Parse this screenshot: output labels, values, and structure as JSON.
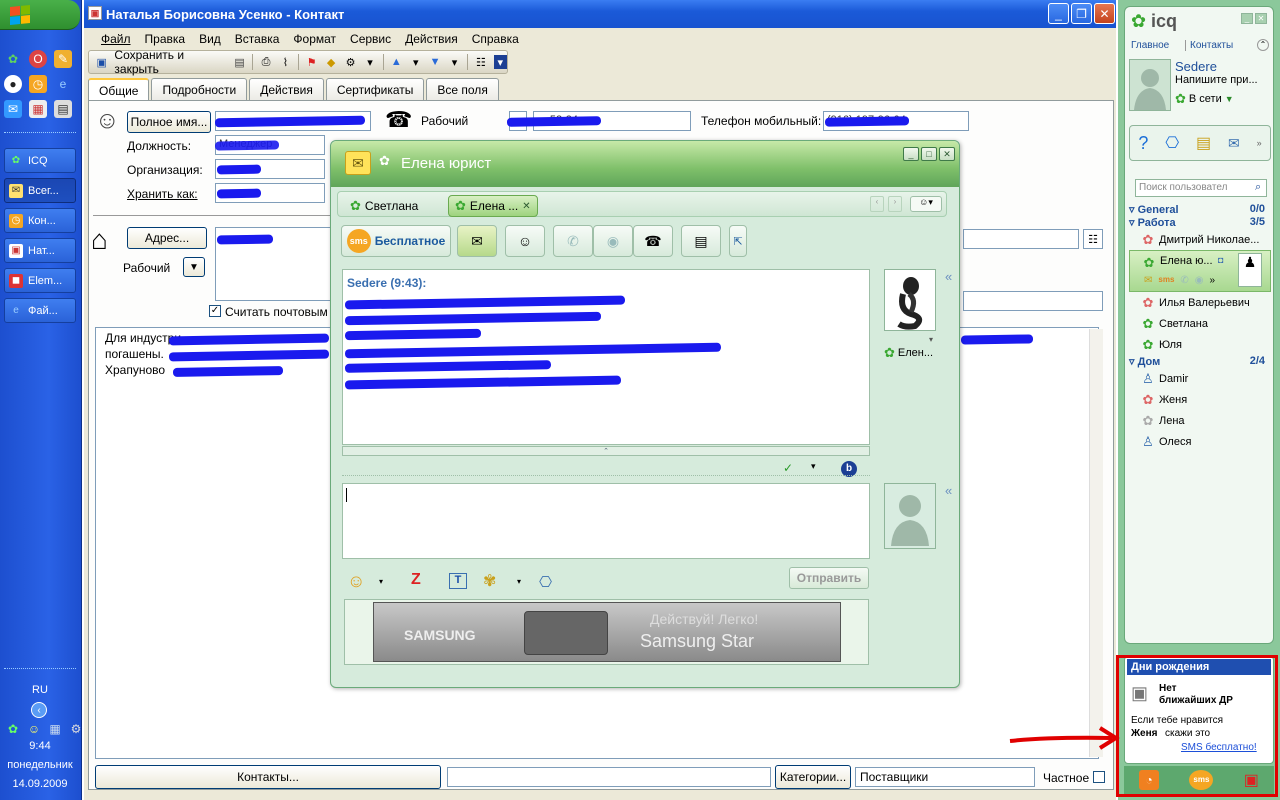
{
  "taskbar": {
    "start_label": "",
    "tasks": [
      {
        "label": "ICQ",
        "icon": "icq-flower-icon"
      },
      {
        "label": "Всег...",
        "icon": "envelope-icon"
      },
      {
        "label": "Кон...",
        "icon": "clock-icon"
      },
      {
        "label": "Нат...",
        "icon": "contact-card-icon"
      },
      {
        "label": "Elem...",
        "icon": "app-icon"
      },
      {
        "label": "Фай...",
        "icon": "ie-icon"
      }
    ],
    "lang": "RU",
    "time": "9:44",
    "day": "понедельник",
    "date": "14.09.2009"
  },
  "outlook": {
    "title": "Наталья Борисовна Усенко - Контакт",
    "menu": [
      "Файл",
      "Правка",
      "Вид",
      "Вставка",
      "Формат",
      "Сервис",
      "Действия",
      "Справка"
    ],
    "toolbar": {
      "save_close": "Сохранить и закрыть"
    },
    "tabs": [
      "Общие",
      "Подробности",
      "Действия",
      "Сертификаты",
      "Все поля"
    ],
    "fullname_btn": "Полное имя...",
    "labels": {
      "position": "Должность:",
      "organization": "Организация:",
      "save_as": "Хранить как:",
      "phone_work": "Рабочий",
      "phone_mobile": "Телефон мобильный:",
      "address_btn": "Адрес...",
      "address_type": "Рабочий",
      "postal": "Считать почтовым"
    },
    "values": {
      "position": "Менеджер",
      "phone_work": "...-52-24",
      "phone_mobile": "(916) 197-96-04"
    },
    "notes": [
      "Для индустри",
      "погашены.",
      "Храпуново"
    ],
    "bottom": {
      "contacts_btn": "Контакты...",
      "categories_btn": "Категории...",
      "categories_value": "Поставщики",
      "private_label": "Частное"
    }
  },
  "chat": {
    "title": "Елена юрист",
    "tabs": [
      {
        "label": "Светлана",
        "active": false
      },
      {
        "label": "Елена ...",
        "active": true
      }
    ],
    "sms_btn": "Бесплатное",
    "message_header": "Sedere (9:43):",
    "contact_name": "Елен...",
    "send_btn": "Отправить",
    "ad_text_1": "SAMSUNG",
    "ad_text_2": "Действуй! Легко!",
    "ad_text_3": "Samsung Star"
  },
  "icq": {
    "logo": "icq",
    "nav": [
      "Главное",
      "Контакты"
    ],
    "user": {
      "name": "Sedere",
      "status_msg": "Напишите при...",
      "status": "В сети"
    },
    "search_placeholder": "Поиск пользовател",
    "groups": [
      {
        "name": "General",
        "count": "0/0",
        "contacts": []
      },
      {
        "name": "Работа",
        "count": "3/5",
        "contacts": [
          {
            "name": "Дмитрий Николае...",
            "status": "offline"
          },
          {
            "name": "Елена ю...",
            "status": "online",
            "selected": true
          },
          {
            "name": "Илья Валерьевич",
            "status": "offline"
          },
          {
            "name": "Светлана",
            "status": "online"
          },
          {
            "name": "Юля",
            "status": "online"
          }
        ]
      },
      {
        "name": "Дом",
        "count": "2/4",
        "contacts": [
          {
            "name": "Damir",
            "status": "away"
          },
          {
            "name": "Женя",
            "status": "offline"
          },
          {
            "name": "Лена",
            "status": "offline"
          },
          {
            "name": "Олеся",
            "status": "online"
          }
        ]
      }
    ],
    "birthday": {
      "header": "Дни рождения",
      "none_1": "Нет",
      "none_2": "ближайших ДР",
      "promo": "Если тебе нравится",
      "promo_name": "Женя",
      "promo_tail": "скажи это",
      "sms_link": "SMS бесплатно!"
    },
    "bottom_sms": "sms"
  },
  "colors": {
    "xp_blue": "#1f5ad8",
    "icq_green": "#8bc89b",
    "redaction": "#1a1aee",
    "annotation_red": "#e00000"
  }
}
